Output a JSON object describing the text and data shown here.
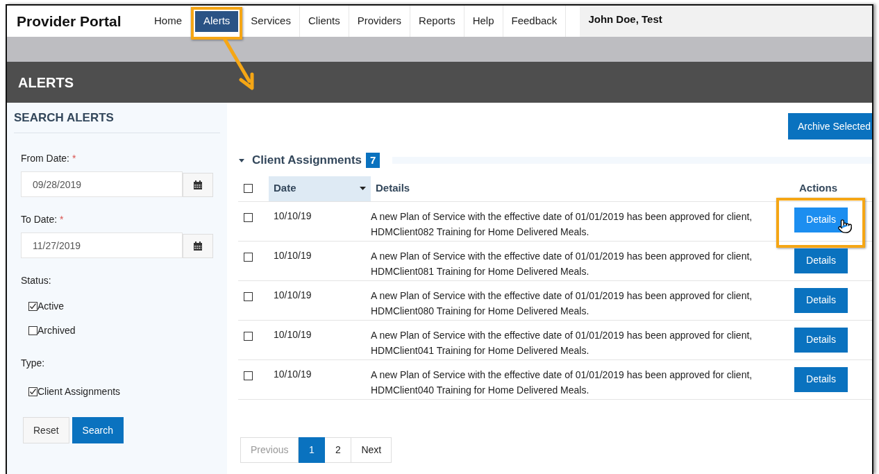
{
  "brand": "Provider Portal",
  "nav": [
    {
      "label": "Home",
      "selected": false,
      "callout": false
    },
    {
      "label": "Alerts",
      "selected": true,
      "callout": true
    },
    {
      "label": "Services",
      "selected": false,
      "callout": false
    },
    {
      "label": "Clients",
      "selected": false,
      "callout": false
    },
    {
      "label": "Providers",
      "selected": false,
      "callout": false
    },
    {
      "label": "Reports",
      "selected": false,
      "callout": false
    },
    {
      "label": "Help",
      "selected": false,
      "callout": false
    },
    {
      "label": "Feedback",
      "selected": false,
      "callout": false
    }
  ],
  "user": "John Doe, Test",
  "page_title": "ALERTS",
  "sidebar": {
    "title": "SEARCH ALERTS",
    "from_date": {
      "label": "From Date:",
      "required": "*",
      "value": "09/28/2019"
    },
    "to_date": {
      "label": "To Date:",
      "required": "*",
      "value": "11/27/2019"
    },
    "status_label": "Status:",
    "status": [
      {
        "label": "Active",
        "checked": true
      },
      {
        "label": "Archived",
        "checked": false
      }
    ],
    "type_label": "Type:",
    "types": [
      {
        "label": "Client Assignments",
        "checked": true
      }
    ],
    "buttons": [
      {
        "label": "Reset",
        "kind": "secondary"
      },
      {
        "label": "Search",
        "kind": "primary"
      }
    ]
  },
  "archive_button": "Archive Selected",
  "section": {
    "title": "Client Assignments",
    "count": "7",
    "expanded": true
  },
  "table": {
    "select_all": false,
    "columns": [
      {
        "label": "Date",
        "sorted": true
      },
      {
        "label": "Details",
        "sorted": false
      },
      {
        "label": "Actions",
        "sorted": false
      }
    ],
    "rows": [
      {
        "checked": false,
        "date": "10/10/19",
        "details": "A new Plan of Service with the effective date of 01/01/2019 has been approved for client, HDMClient082 Training for Home Delivered Meals.",
        "action": "Details",
        "callout": true
      },
      {
        "checked": false,
        "date": "10/10/19",
        "details": "A new Plan of Service with the effective date of 01/01/2019 has been approved for client, HDMClient081 Training for Home Delivered Meals.",
        "action": "Details",
        "callout": false
      },
      {
        "checked": false,
        "date": "10/10/19",
        "details": "A new Plan of Service with the effective date of 01/01/2019 has been approved for client, HDMClient080 Training for Home Delivered Meals.",
        "action": "Details",
        "callout": false
      },
      {
        "checked": false,
        "date": "10/10/19",
        "details": "A new Plan of Service with the effective date of 01/01/2019 has been approved for client, HDMClient041 Training for Home Delivered Meals.",
        "action": "Details",
        "callout": false
      },
      {
        "checked": false,
        "date": "10/10/19",
        "details": "A new Plan of Service with the effective date of 01/01/2019 has been approved for client, HDMClient040 Training for Home Delivered Meals.",
        "action": "Details",
        "callout": false
      }
    ]
  },
  "pagination": {
    "previous": {
      "label": "Previous",
      "disabled": true
    },
    "pages": [
      {
        "label": "1",
        "selected": true
      },
      {
        "label": "2",
        "selected": false
      }
    ],
    "next": {
      "label": "Next",
      "disabled": false
    }
  }
}
